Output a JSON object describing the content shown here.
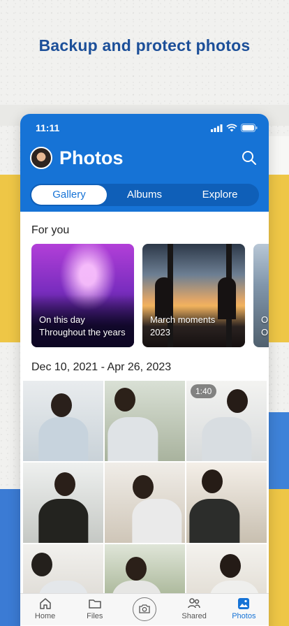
{
  "headline": "Backup and protect photos",
  "status": {
    "time": "11:11"
  },
  "header": {
    "title": "Photos"
  },
  "tabs": [
    {
      "label": "Gallery",
      "active": true
    },
    {
      "label": "Albums",
      "active": false
    },
    {
      "label": "Explore",
      "active": false
    }
  ],
  "for_you": {
    "title": "For you",
    "cards": [
      {
        "line1": "On this day",
        "line2": "Throughout the years"
      },
      {
        "line1": "March moments",
        "line2": "2023"
      },
      {
        "line1": "O",
        "line2": "O"
      }
    ]
  },
  "gallery": {
    "date_range": "Dec 10, 2021 - Apr 26, 2023",
    "video_duration": "1:40"
  },
  "nav": {
    "home": "Home",
    "files": "Files",
    "shared": "Shared",
    "photos": "Photos"
  },
  "colors": {
    "accent": "#1673d6",
    "headline": "#1c4f99"
  },
  "icons": [
    "search-icon",
    "signal-icon",
    "wifi-icon",
    "battery-icon",
    "home-icon",
    "folder-icon",
    "camera-icon",
    "people-icon",
    "photos-icon"
  ]
}
